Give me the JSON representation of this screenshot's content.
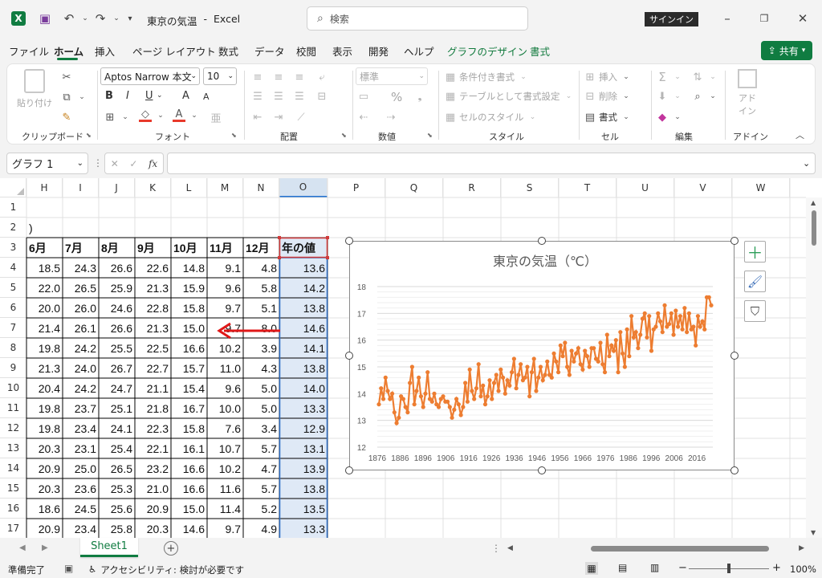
{
  "titlebar": {
    "doc_title": "東京の気温",
    "sep": "-",
    "app_name": "Excel",
    "search_placeholder": "検索",
    "signin_label": "サインイン"
  },
  "tabs": [
    {
      "label": "ファイル",
      "x": 11,
      "style": ""
    },
    {
      "label": "ホーム",
      "x": 67,
      "style": "active"
    },
    {
      "label": "挿入",
      "x": 118,
      "style": ""
    },
    {
      "label": "ページ レイアウト",
      "x": 165,
      "style": ""
    },
    {
      "label": "数式",
      "x": 272,
      "style": ""
    },
    {
      "label": "データ",
      "x": 317,
      "style": ""
    },
    {
      "label": "校閲",
      "x": 369,
      "style": ""
    },
    {
      "label": "表示",
      "x": 414,
      "style": ""
    },
    {
      "label": "開発",
      "x": 459,
      "style": ""
    },
    {
      "label": "ヘルプ",
      "x": 503,
      "style": ""
    },
    {
      "label": "グラフのデザイン",
      "x": 557,
      "style": "green"
    },
    {
      "label": "書式",
      "x": 660,
      "style": "green"
    }
  ],
  "share_label": "共有",
  "ribbon": {
    "clipboard": {
      "paste": "貼り付け",
      "label": "クリップボード"
    },
    "font": {
      "name": "Aptos Narrow 本文",
      "size": "10",
      "bold": "B",
      "italic": "I",
      "underline": "U",
      "grow": "A",
      "shrink": "A",
      "label": "フォント"
    },
    "align": {
      "label": "配置"
    },
    "number": {
      "format": "標準",
      "percent": "%",
      "label": "数値"
    },
    "style": {
      "cond": "条件付き書式",
      "table": "テーブルとして書式設定",
      "cell": "セルのスタイル",
      "label": "スタイル"
    },
    "cells": {
      "insert": "挿入",
      "delete": "削除",
      "format": "書式",
      "label": "セル"
    },
    "edit": {
      "label": "編集"
    },
    "addin": {
      "name_line1": "アド",
      "name_line2": "イン",
      "label": "アドイン"
    }
  },
  "formula_bar": {
    "name_box": "グラフ 1",
    "fx": "fx",
    "value": ""
  },
  "columns": [
    {
      "l": "H",
      "w": 45
    },
    {
      "l": "I",
      "w": 45
    },
    {
      "l": "J",
      "w": 45
    },
    {
      "l": "K",
      "w": 45
    },
    {
      "l": "L",
      "w": 45
    },
    {
      "l": "M",
      "w": 45
    },
    {
      "l": "N",
      "w": 45
    },
    {
      "l": "O",
      "w": 60
    },
    {
      "l": "P",
      "w": 72
    },
    {
      "l": "Q",
      "w": 72
    },
    {
      "l": "R",
      "w": 72
    },
    {
      "l": "S",
      "w": 72
    },
    {
      "l": "T",
      "w": 72
    },
    {
      "l": "U",
      "w": 72
    },
    {
      "l": "V",
      "w": 72
    },
    {
      "l": "W",
      "w": 72
    }
  ],
  "row_numbers": [
    "1",
    "2",
    "3",
    "4",
    "5",
    "6",
    "7",
    "8",
    "9",
    "10",
    "11",
    "12",
    "13",
    "14",
    "15",
    "16",
    "17"
  ],
  "row2_text": ")",
  "table_headers": [
    "6月",
    "7月",
    "8月",
    "9月",
    "10月",
    "11月",
    "12月",
    "年の値"
  ],
  "table_rows": [
    [
      "18.5",
      "24.3",
      "26.6",
      "22.6",
      "14.8",
      "9.1",
      "4.8",
      "13.6"
    ],
    [
      "22.0",
      "26.5",
      "25.9",
      "21.3",
      "15.9",
      "9.6",
      "5.8",
      "14.2"
    ],
    [
      "20.0",
      "26.0",
      "24.6",
      "22.8",
      "15.8",
      "9.7",
      "5.1",
      "13.8"
    ],
    [
      "21.4",
      "26.1",
      "26.6",
      "21.3",
      "15.0",
      "9.7",
      "8.0",
      "14.6"
    ],
    [
      "19.8",
      "24.2",
      "25.5",
      "22.5",
      "16.6",
      "10.2",
      "3.9",
      "14.1"
    ],
    [
      "21.3",
      "24.0",
      "26.7",
      "22.7",
      "15.7",
      "11.0",
      "4.3",
      "13.8"
    ],
    [
      "20.4",
      "24.2",
      "24.7",
      "21.1",
      "15.4",
      "9.6",
      "5.0",
      "14.0"
    ],
    [
      "19.8",
      "23.7",
      "25.1",
      "21.8",
      "16.7",
      "10.0",
      "5.0",
      "13.3"
    ],
    [
      "19.8",
      "23.4",
      "24.1",
      "22.3",
      "15.8",
      "7.6",
      "3.4",
      "12.9"
    ],
    [
      "20.3",
      "23.1",
      "25.4",
      "22.1",
      "16.1",
      "10.7",
      "5.7",
      "13.1"
    ],
    [
      "20.9",
      "25.0",
      "26.5",
      "23.2",
      "16.6",
      "10.2",
      "4.7",
      "13.9"
    ],
    [
      "20.3",
      "23.6",
      "25.3",
      "21.0",
      "16.6",
      "11.6",
      "5.7",
      "13.8"
    ],
    [
      "18.6",
      "24.5",
      "25.6",
      "20.9",
      "15.0",
      "11.4",
      "5.2",
      "13.5"
    ],
    [
      "20.9",
      "23.4",
      "25.8",
      "20.3",
      "14.6",
      "9.7",
      "4.9",
      "13.3"
    ]
  ],
  "chart_data": {
    "type": "line",
    "title": "東京の気温（℃）",
    "ylim": [
      12,
      18
    ],
    "yticks": [
      "12",
      "13",
      "14",
      "15",
      "16",
      "17",
      "18"
    ],
    "xticks": [
      "1876",
      "1886",
      "1896",
      "1906",
      "1916",
      "1926",
      "1936",
      "1946",
      "1956",
      "1966",
      "1976",
      "1986",
      "1996",
      "2006",
      "2016"
    ],
    "x_start": 1876,
    "x_end": 2023,
    "line_color": "#ed7d31",
    "values": [
      13.6,
      14.2,
      13.8,
      14.6,
      14.1,
      13.8,
      14.0,
      13.3,
      12.9,
      13.1,
      13.9,
      13.8,
      13.5,
      13.3,
      14.4,
      15.0,
      13.6,
      14.1,
      14.6,
      13.9,
      13.5,
      14.0,
      14.8,
      13.8,
      13.7,
      14.0,
      13.6,
      13.5,
      13.8,
      13.9,
      13.7,
      13.7,
      13.5,
      13.1,
      13.4,
      13.8,
      13.6,
      13.2,
      13.5,
      14.4,
      13.7,
      14.9,
      14.1,
      13.8,
      14.2,
      15.1,
      13.9,
      14.3,
      13.6,
      13.9,
      14.5,
      13.8,
      14.4,
      14.7,
      14.1,
      14.9,
      14.6,
      14.0,
      14.5,
      14.3,
      14.8,
      15.3,
      14.2,
      14.7,
      15.1,
      14.5,
      14.6,
      15.0,
      13.9,
      14.8,
      15.3,
      14.1,
      14.6,
      15.0,
      14.5,
      14.7,
      15.2,
      14.7,
      14.6,
      15.5,
      15.2,
      14.8,
      15.8,
      15.4,
      15.9,
      15.0,
      14.7,
      15.6,
      15.2,
      15.5,
      15.7,
      15.1,
      14.9,
      15.6,
      15.4,
      15.0,
      15.7,
      15.7,
      15.3,
      15.2,
      15.9,
      15.1,
      14.8,
      16.2,
      15.4,
      15.8,
      15.6,
      16.0,
      14.8,
      16.3,
      15.5,
      15.0,
      16.4,
      15.4,
      16.9,
      16.1,
      16.3,
      15.7,
      16.2,
      16.8,
      17.0,
      16.1,
      16.9,
      15.6,
      16.4,
      16.5,
      17.0,
      16.7,
      16.3,
      17.3,
      16.5,
      16.6,
      17.0,
      16.2,
      17.1,
      16.5,
      16.9,
      16.4,
      17.2,
      16.3,
      17.0,
      16.4,
      16.5,
      15.8,
      16.9,
      16.5,
      16.7,
      16.4,
      17.6,
      17.6,
      17.3
    ]
  },
  "sheet": {
    "name": "Sheet1",
    "add": "+"
  },
  "status": {
    "ready": "準備完了",
    "accessibility": "アクセシビリティ: 検討が必要です",
    "zoom": "100%",
    "zoom_minus": "−",
    "zoom_plus": "+"
  }
}
